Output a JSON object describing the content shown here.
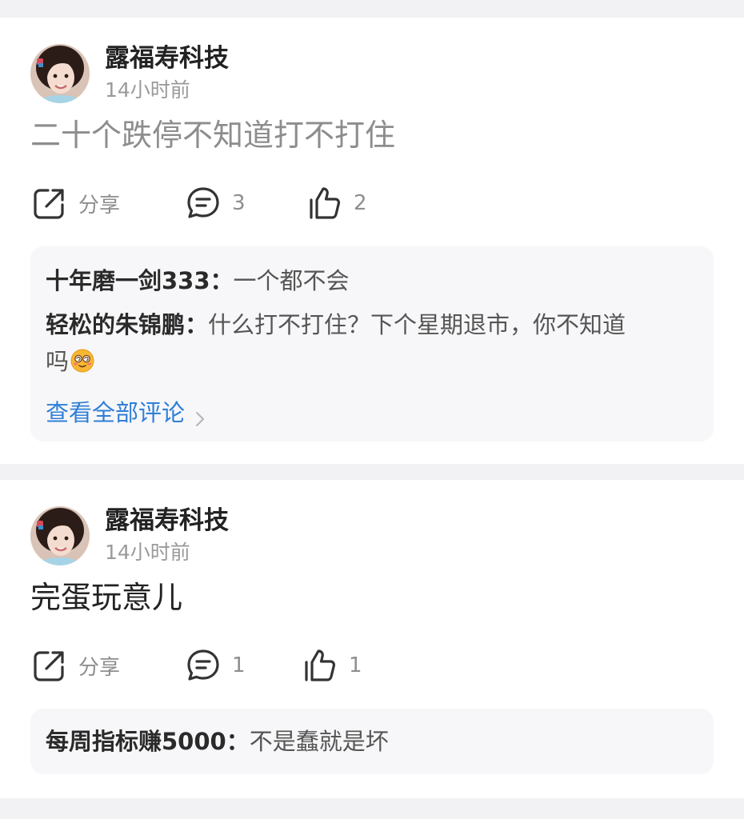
{
  "posts": [
    {
      "username": "露福寿科技",
      "time": "14小时前",
      "text": "二十个跌停不知道打不打住",
      "actions": {
        "share_label": "分享",
        "comment_count": "3",
        "like_count": "2"
      },
      "comments": [
        {
          "author": "十年磨一剑333：",
          "text": "一个都不会"
        },
        {
          "author": "轻松的朱锦鹏：",
          "text": "什么打不打住？下个星期退市，你不知道",
          "text_cont": "吗",
          "emoji": "dizzy-face-emoji"
        }
      ],
      "view_all_label": "查看全部评论"
    },
    {
      "username": "露福寿科技",
      "time": "14小时前",
      "text": "完蛋玩意儿",
      "actions": {
        "share_label": "分享",
        "comment_count": "1",
        "like_count": "1"
      },
      "comments": [
        {
          "author": "每周指标赚5000：",
          "text": "不是蠢就是坏"
        }
      ]
    }
  ],
  "icons": {
    "share": "share-icon",
    "comment": "comment-icon",
    "like": "thumbs-up-icon",
    "chevron": "chevron-right-icon"
  },
  "colors": {
    "link": "#2f7fd6",
    "muted_text": "#8d8d8d",
    "comment_box_bg": "#f7f7f9",
    "page_bg": "#f2f2f4"
  }
}
